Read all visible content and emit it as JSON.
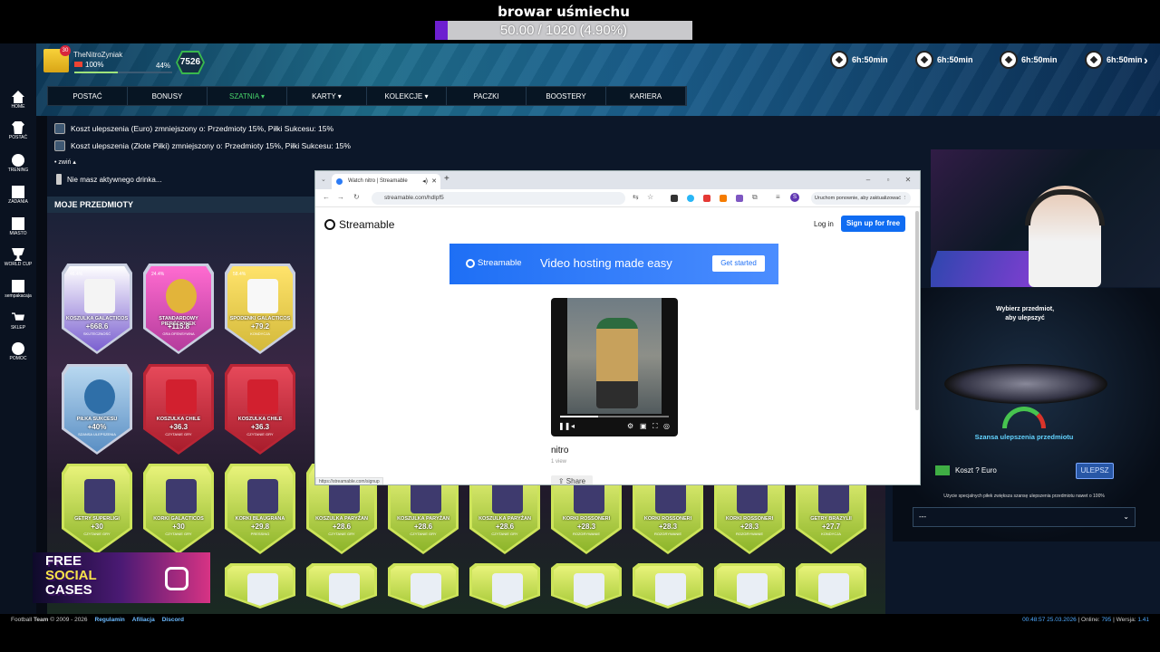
{
  "overlay": {
    "goal_title": "browar uśmiechu",
    "goal_progress": "50.00 / 1020 (4.90%)",
    "goal_fraction": 0.049
  },
  "profile": {
    "avatar_badge": "30",
    "username": "TheNitroZyniak",
    "health": "100%",
    "xp_percent": "44%",
    "level": "7526"
  },
  "timers": [
    "6h:50min",
    "6h:50min",
    "6h:50min",
    "6h:50min"
  ],
  "nav": [
    "POSTAĆ",
    "BONUSY",
    "SZATNIA",
    "KARTY",
    "KOLEKCJE",
    "PACZKI",
    "BOOSTERY",
    "KARIERA"
  ],
  "sidebar": [
    "HOME",
    "POSTAĆ",
    "TRENING",
    "ZADANIA",
    "MIASTO",
    "WORLD CUP",
    "sempakacaja",
    "SKLEP",
    "POMOC"
  ],
  "notifications": [
    "Koszt ulepszenia (Euro) zmniejszony o: Przedmioty 15%, Piłki Sukcesu: 15%",
    "Koszt ulepszenia (Złote Piłki) zmniejszony o: Przedmioty 15%, Piłki Sukcesu: 15%"
  ],
  "collapse_label": "zwiń",
  "drink_note": "Nie masz aktywnego drinka...",
  "items_header": "MOJE PRZEDMIOTY",
  "cards": {
    "row1": [
      {
        "name": "KOSZULKA GALACTICOS",
        "bonus": "+668.6",
        "sub": "SKUTECZNOŚĆ",
        "pct": "46.4%",
        "color": "#7a5fd0"
      },
      {
        "name": "STANDARDOWY PIERŚCIONEK",
        "bonus": "+115.8",
        "sub": "GRA OFENSYWNA",
        "pct": "24.4%",
        "color": "#b43c9c"
      },
      {
        "name": "SPODENKI GALACTICOS",
        "bonus": "+79.2",
        "sub": "KONDYCJA",
        "pct": "58.4%",
        "color": "#d3b93a"
      }
    ],
    "row2": [
      {
        "name": "PIŁKA SUKCESU",
        "bonus": "+40%",
        "sub": "SZANSA ULEPSZENIA",
        "color": "#5b8fc4"
      },
      {
        "name": "KOSZULKA CHILE",
        "bonus": "+36.3",
        "sub": "CZYTANIE GRY",
        "color": "#c9283a"
      },
      {
        "name": "KOSZULKA CHILE",
        "bonus": "+36.3",
        "sub": "CZYTANIE GRY",
        "color": "#c9283a"
      }
    ],
    "row3": [
      {
        "name": "GETRY SUPERLIGI",
        "bonus": "+30",
        "sub": "CZYTANIE GRY"
      },
      {
        "name": "KORKI GALACTICOS",
        "bonus": "+30",
        "sub": "CZYTANIE GRY"
      },
      {
        "name": "KORKI BLAUGRANA",
        "bonus": "+29.8",
        "sub": "PRESSING"
      },
      {
        "name": "KOSZULKA PARYŻAN",
        "bonus": "+28.6",
        "sub": "CZYTANIE GRY"
      },
      {
        "name": "KOSZULKA PARYŻAN",
        "bonus": "+28.6",
        "sub": "CZYTANIE GRY"
      },
      {
        "name": "KOSZULKA PARYŻAN",
        "bonus": "+28.6",
        "sub": "CZYTANIE GRY"
      },
      {
        "name": "KORKI ROSSONERI",
        "bonus": "+28.3",
        "sub": "ROZGRYWANIE"
      },
      {
        "name": "KORKI ROSSONERI",
        "bonus": "+28.3",
        "sub": "ROZGRYWANIE"
      },
      {
        "name": "KORKI ROSSONERI",
        "bonus": "+28.3",
        "sub": "ROZGRYWANIE"
      },
      {
        "name": "GETRY BRAZYLII",
        "bonus": "+27.7",
        "sub": "KONDYCJA"
      }
    ]
  },
  "promo": {
    "line1": "FREE",
    "line2": "SOCIAL",
    "line3": "CASES"
  },
  "upgrade": {
    "hint": "Wybierz przedmiot, aby ulepszyć",
    "chance_label": "Szansa ulepszenia przedmiotu",
    "cost": "Koszt ? Euro",
    "button": "ULEPSZ",
    "special_note": "Użycie specjalnych piłek zwiększa szansę ulepszenia przedmiotu nawet o 100%",
    "special_value": "---"
  },
  "browser": {
    "tab_title": "Watch nitro | Streamable",
    "url": "streamable.com/hdlpf5",
    "update_button": "Uruchom ponownie, aby zaktualizować",
    "profile_initial": "S",
    "logo": "Streamable",
    "login": "Log in",
    "signup": "Sign up for free",
    "banner_logo": "Streamable",
    "banner_tagline": "Video hosting made easy",
    "banner_cta": "Get started",
    "video_title": "nitro",
    "video_views": "1 view",
    "share": "Share",
    "status_url": "https://streamable.com/signup",
    "video_progress": 0.35
  },
  "footer": {
    "copyright_prefix": "Football",
    "copyright_bold": "Team",
    "copyright_suffix": "© 2009 - 2026",
    "links": [
      "Regulamin",
      "Afiliacja",
      "Discord"
    ],
    "time": "00:48:57 25.03.2026",
    "online_label": "Online:",
    "online_count": "795",
    "version_label": "Wersja:",
    "version": "1.41"
  }
}
